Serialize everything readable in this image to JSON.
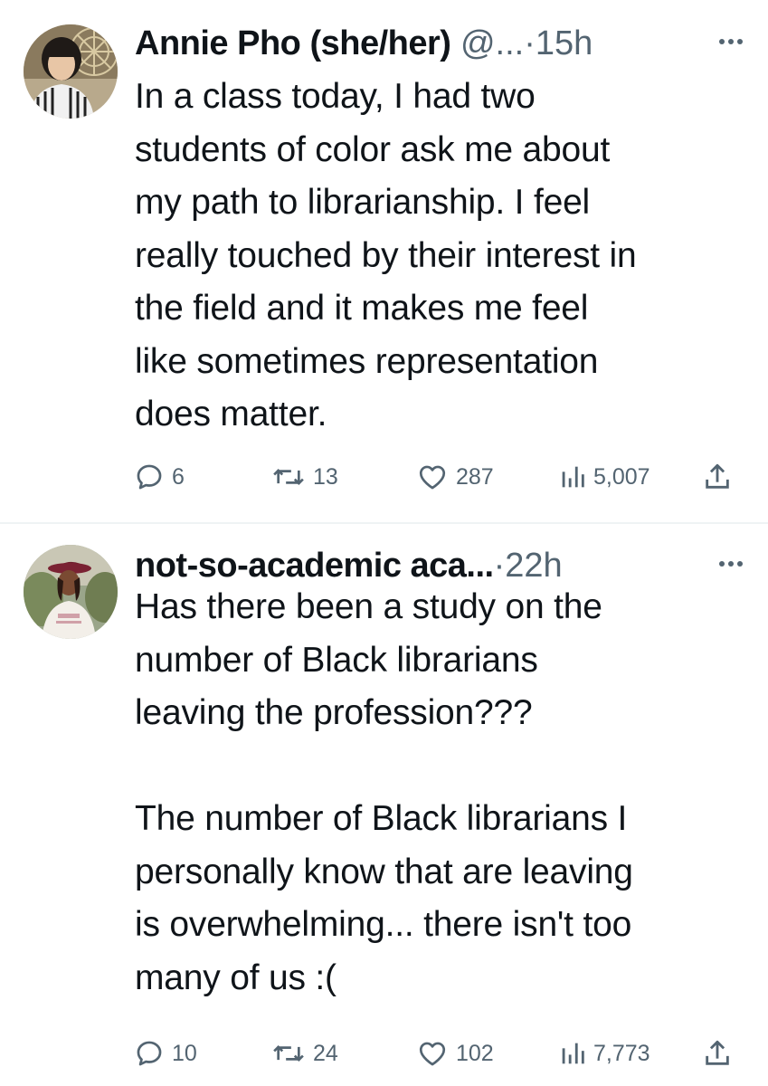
{
  "tweets": [
    {
      "author_name": "Annie Pho (she/her)",
      "handle": "@...",
      "separator": "·",
      "time": "15h",
      "text": "In a class today, I had two\nstudents of color ask me about\nmy path to librarianship. I feel\nreally touched by their interest in\nthe field and it makes me feel\nlike sometimes representation\ndoes matter.",
      "avatar_icon": "profile-photo",
      "more_icon": "more-dots-icon",
      "replies": "6",
      "reposts": "13",
      "likes": "287",
      "views": "5,007"
    },
    {
      "author_name": "not-so-academic aca...",
      "handle": "",
      "separator": "·",
      "time": "22h",
      "text": "Has there been a study on the\nnumber of Black librarians\nleaving the profession???\n\nThe number of Black librarians I\npersonally know that are leaving\nis overwhelming... there isn't too\nmany of us :(",
      "avatar_icon": "profile-photo",
      "more_icon": "more-dots-icon",
      "replies": "10",
      "reposts": "24",
      "likes": "102",
      "views": "7,773"
    }
  ],
  "colors": {
    "text": "#0f1419",
    "secondary": "#536471",
    "divider": "#eff3f4"
  },
  "icons": {
    "reply": "reply-icon",
    "repost": "repost-icon",
    "like": "heart-icon",
    "views": "views-chart-icon",
    "share": "share-icon"
  }
}
